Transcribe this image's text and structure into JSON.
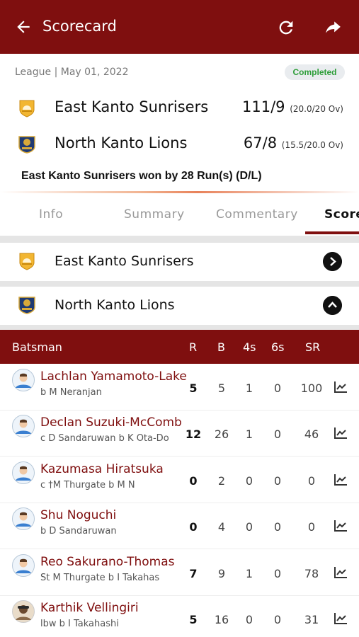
{
  "appbar": {
    "title": "Scorecard"
  },
  "match": {
    "meta": "League | May 01, 2022",
    "status": "Completed",
    "teams": [
      {
        "name": "East Kanto Sunrisers",
        "score": "111/9",
        "overs": "(20.0/20 Ov)"
      },
      {
        "name": "North Kanto Lions",
        "score": "67/8",
        "overs": "(15.5/20.0 Ov)"
      }
    ],
    "result": "East Kanto Sunrisers won by 28 Run(s) (D/L)"
  },
  "tabs": [
    {
      "label": "Info"
    },
    {
      "label": "Summary"
    },
    {
      "label": "Commentary"
    },
    {
      "label": "Score"
    }
  ],
  "innings": [
    {
      "name": "East Kanto Sunrisers",
      "toggle": "expand"
    },
    {
      "name": "North Kanto Lions",
      "toggle": "collapse"
    }
  ],
  "table": {
    "headers": {
      "batsman": "Batsman",
      "r": "R",
      "b": "B",
      "fours": "4s",
      "sixes": "6s",
      "sr": "SR"
    },
    "rows": [
      {
        "name": "Lachlan Yamamoto-Lake",
        "dismissal": "b M Neranjan",
        "r": "5",
        "b": "5",
        "fours": "1",
        "sixes": "0",
        "sr": "100"
      },
      {
        "name": "Declan Suzuki-McComb",
        "dismissal": "c D Sandaruwan b K Ota-Do",
        "r": "12",
        "b": "26",
        "fours": "1",
        "sixes": "0",
        "sr": "46"
      },
      {
        "name": "Kazumasa Hiratsuka",
        "dismissal": "c †M Thurgate b M N",
        "r": "0",
        "b": "2",
        "fours": "0",
        "sixes": "0",
        "sr": "0"
      },
      {
        "name": "Shu Noguchi",
        "dismissal": "b D Sandaruwan",
        "r": "0",
        "b": "4",
        "fours": "0",
        "sixes": "0",
        "sr": "0"
      },
      {
        "name": "Reo Sakurano-Thomas",
        "dismissal": "St M Thurgate b I Takahas",
        "r": "7",
        "b": "9",
        "fours": "1",
        "sixes": "0",
        "sr": "78"
      },
      {
        "name": "Karthik Vellingiri",
        "dismissal": "lbw b I Takahashi",
        "r": "5",
        "b": "16",
        "fours": "0",
        "sixes": "0",
        "sr": "31"
      }
    ]
  },
  "colors": {
    "brand": "#7f0f0f",
    "completed": "#2e9e3a"
  }
}
